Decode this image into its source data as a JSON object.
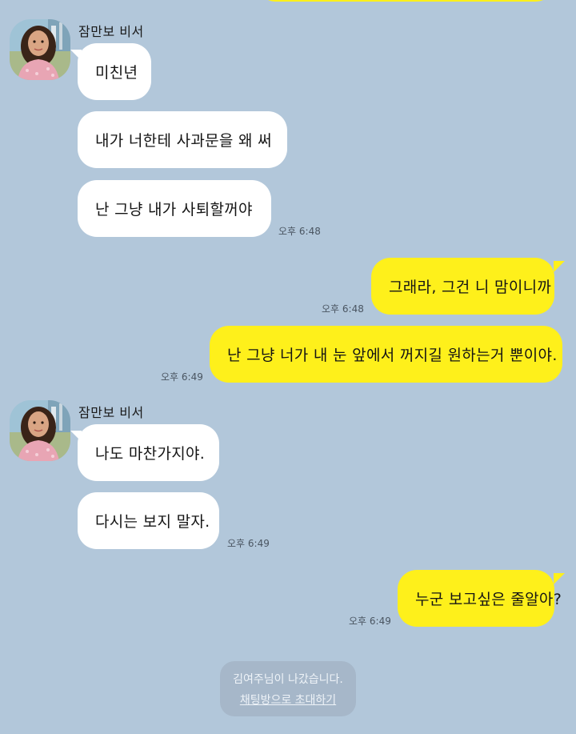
{
  "chat": {
    "sender_1": "잠만보 비서",
    "msg_1": "미친년",
    "msg_2": "내가 너한테 사과문을 왜 써",
    "msg_3": "난 그냥 내가 사퇴할꺼야",
    "time_1": "오후 6:48",
    "msg_4": "그래라, 그건 니 맘이니까",
    "time_2": "오후 6:48",
    "msg_5": "난 그냥 너가 내 눈 앞에서 꺼지길 원하는거 뿐이야.",
    "time_3": "오후 6:49",
    "sender_2": "잠만보 비서",
    "msg_6": "나도 마찬가지야.",
    "msg_7": "다시는 보지 말자.",
    "time_4": "오후 6:49",
    "msg_8": "누군 보고싶은 줄알아?",
    "time_5": "오후 6:49"
  },
  "notice": {
    "left_text": "김여주님이 나갔습니다.",
    "invite_link": "채팅방으로 초대하기"
  },
  "colors": {
    "background": "#b2c7da",
    "incoming_bubble": "#ffffff",
    "outgoing_bubble": "#fef01b"
  }
}
